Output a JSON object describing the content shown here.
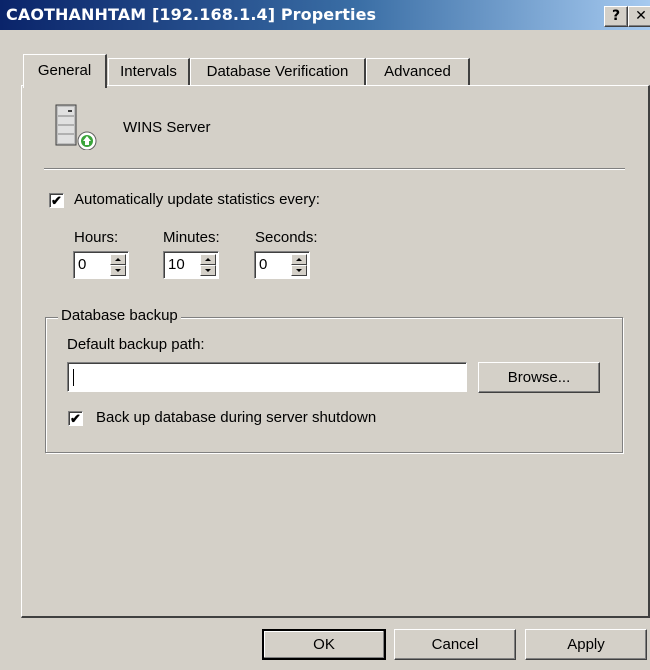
{
  "window": {
    "title": "CAOTHANHTAM [192.168.1.4] Properties",
    "help_button": "?",
    "close_button": "✕"
  },
  "tabs": [
    {
      "label": "General",
      "active": true
    },
    {
      "label": "Intervals",
      "active": false
    },
    {
      "label": "Database Verification",
      "active": false
    },
    {
      "label": "Advanced",
      "active": false
    }
  ],
  "general": {
    "server_icon": "wins-server-icon",
    "server_label": "WINS Server",
    "auto_update": {
      "checked": true,
      "label": "Automatically update statistics every:"
    },
    "hours": {
      "label": "Hours:",
      "value": "0"
    },
    "minutes": {
      "label": "Minutes:",
      "value": "10"
    },
    "seconds": {
      "label": "Seconds:",
      "value": "0"
    },
    "database_backup": {
      "title": "Database backup",
      "path_label": "Default backup path:",
      "path_value": "",
      "browse_button": "Browse...",
      "shutdown_backup": {
        "checked": true,
        "label": "Back up database during server shutdown"
      }
    }
  },
  "footer": {
    "ok": "OK",
    "cancel": "Cancel",
    "apply": "Apply"
  },
  "colors": {
    "title_bar_start": "#0a246a",
    "title_bar_end": "#a6caf0",
    "face": "#d4d0c8"
  }
}
